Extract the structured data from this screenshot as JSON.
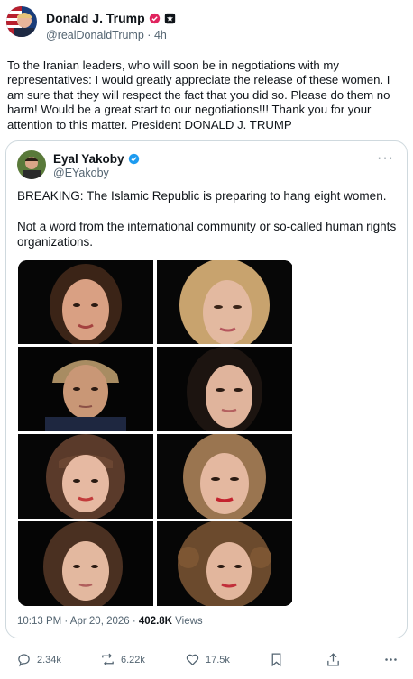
{
  "post": {
    "author_name": "Donald J. Trump",
    "author_handle": "@realDonaldTrump",
    "separator": "·",
    "time_ago": "4h",
    "text": "To the Iranian leaders, who will soon be in negotiations with my representatives: I would greatly appreciate the release of these women. I am sure that they will respect the fact that you did so. Please do them no harm! Would be a great start to our negotiations!!! Thank you for your attention to this matter. President DONALD J. TRUMP"
  },
  "quoted": {
    "author_name": "Eyal Yakoby",
    "author_handle": "@EYakoby",
    "more": "···",
    "text_line1": "BREAKING: The Islamic Republic is preparing to hang eight women.",
    "text_line2": "Not a word from the international community or so-called human rights organizations.",
    "photo_count": 8,
    "timestamp": "10:13 PM · Apr 20, 2026 · ",
    "views_count": "402.8K",
    "views_label": " Views"
  },
  "actions": {
    "replies": "2.34k",
    "reposts": "6.22k",
    "likes": "17.5k"
  },
  "colors": {
    "verified_pink": "#e0245e",
    "verified_blue": "#1d9bf0",
    "muted": "#536471"
  }
}
